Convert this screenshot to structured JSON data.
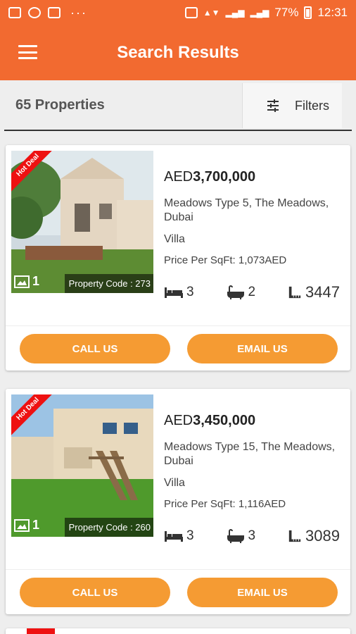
{
  "status_bar": {
    "battery": "77%",
    "time": "12:31"
  },
  "app_bar": {
    "title": "Search Results"
  },
  "results": {
    "count_label": "65 Properties",
    "filters_label": "Filters"
  },
  "listings": [
    {
      "badge": "Hot Deal",
      "currency": "AED",
      "amount": "3,700,000",
      "address": "Meadows Type 5, The Meadows, Dubai",
      "type": "Villa",
      "price_per_sqft": "Price Per SqFt: 1,073AED",
      "image_count": "1",
      "property_code": "Property Code : 273",
      "bedrooms": "3",
      "bathrooms": "2",
      "area": "3447",
      "call_label": "CALL US",
      "email_label": "EMAIL US"
    },
    {
      "badge": "Hot Deal",
      "currency": "AED",
      "amount": "3,450,000",
      "address": "Meadows Type 15, The Meadows, Dubai",
      "type": "Villa",
      "price_per_sqft": "Price Per SqFt: 1,116AED",
      "image_count": "1",
      "property_code": "Property Code : 260",
      "bedrooms": "3",
      "bathrooms": "3",
      "area": "3089",
      "call_label": "CALL US",
      "email_label": "EMAIL US"
    }
  ]
}
